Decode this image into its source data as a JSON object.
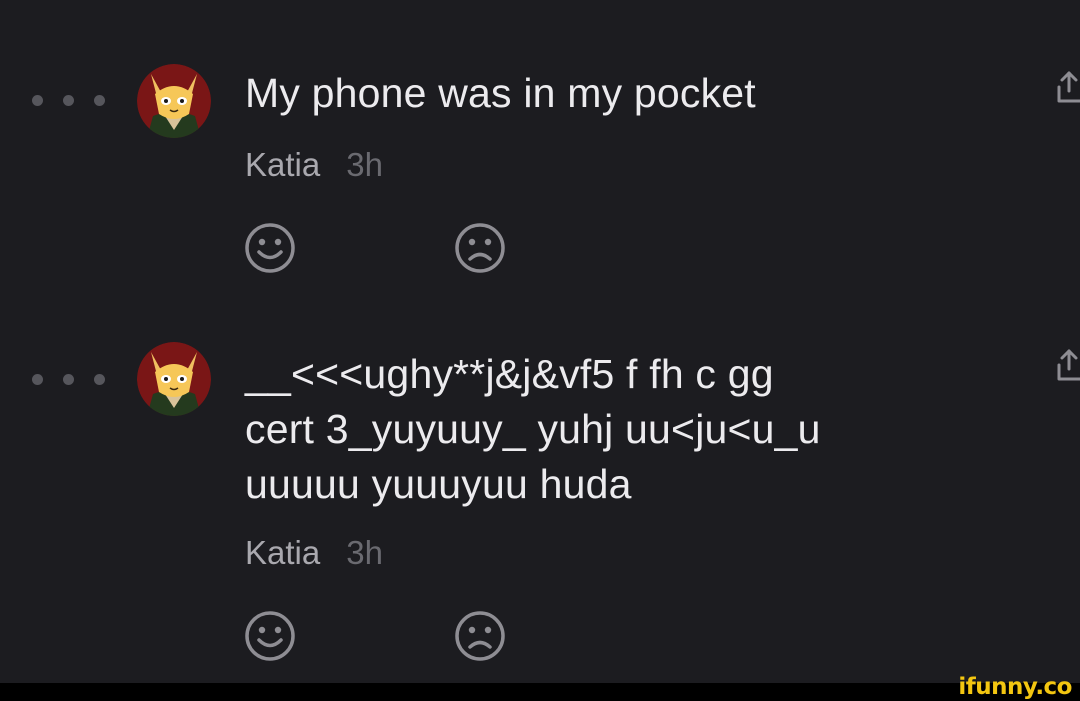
{
  "posts": [
    {
      "message": "My phone was in my pocket",
      "author": "Katia",
      "time": "3h",
      "reactions": [
        "smile-icon",
        "frown-icon"
      ],
      "share_icon": "share-icon"
    },
    {
      "message": "__<<<ughy**j&j&vf5 f fh c gg\ncert 3_yuyuuy_ yuhj uu<ju<u_u\nuuuuu yuuuyuu huda",
      "author": "Katia",
      "time": "3h",
      "reactions": [
        "smile-icon",
        "frown-icon"
      ],
      "share_icon": "share-icon"
    }
  ],
  "colors": {
    "background": "#1c1c20",
    "text": "#ecebee",
    "meta_author": "#a9a8ae",
    "meta_time": "#6a6a70",
    "icon": "#8e8d93",
    "watermark": "#f3c611"
  },
  "watermark": "ifunny.co"
}
